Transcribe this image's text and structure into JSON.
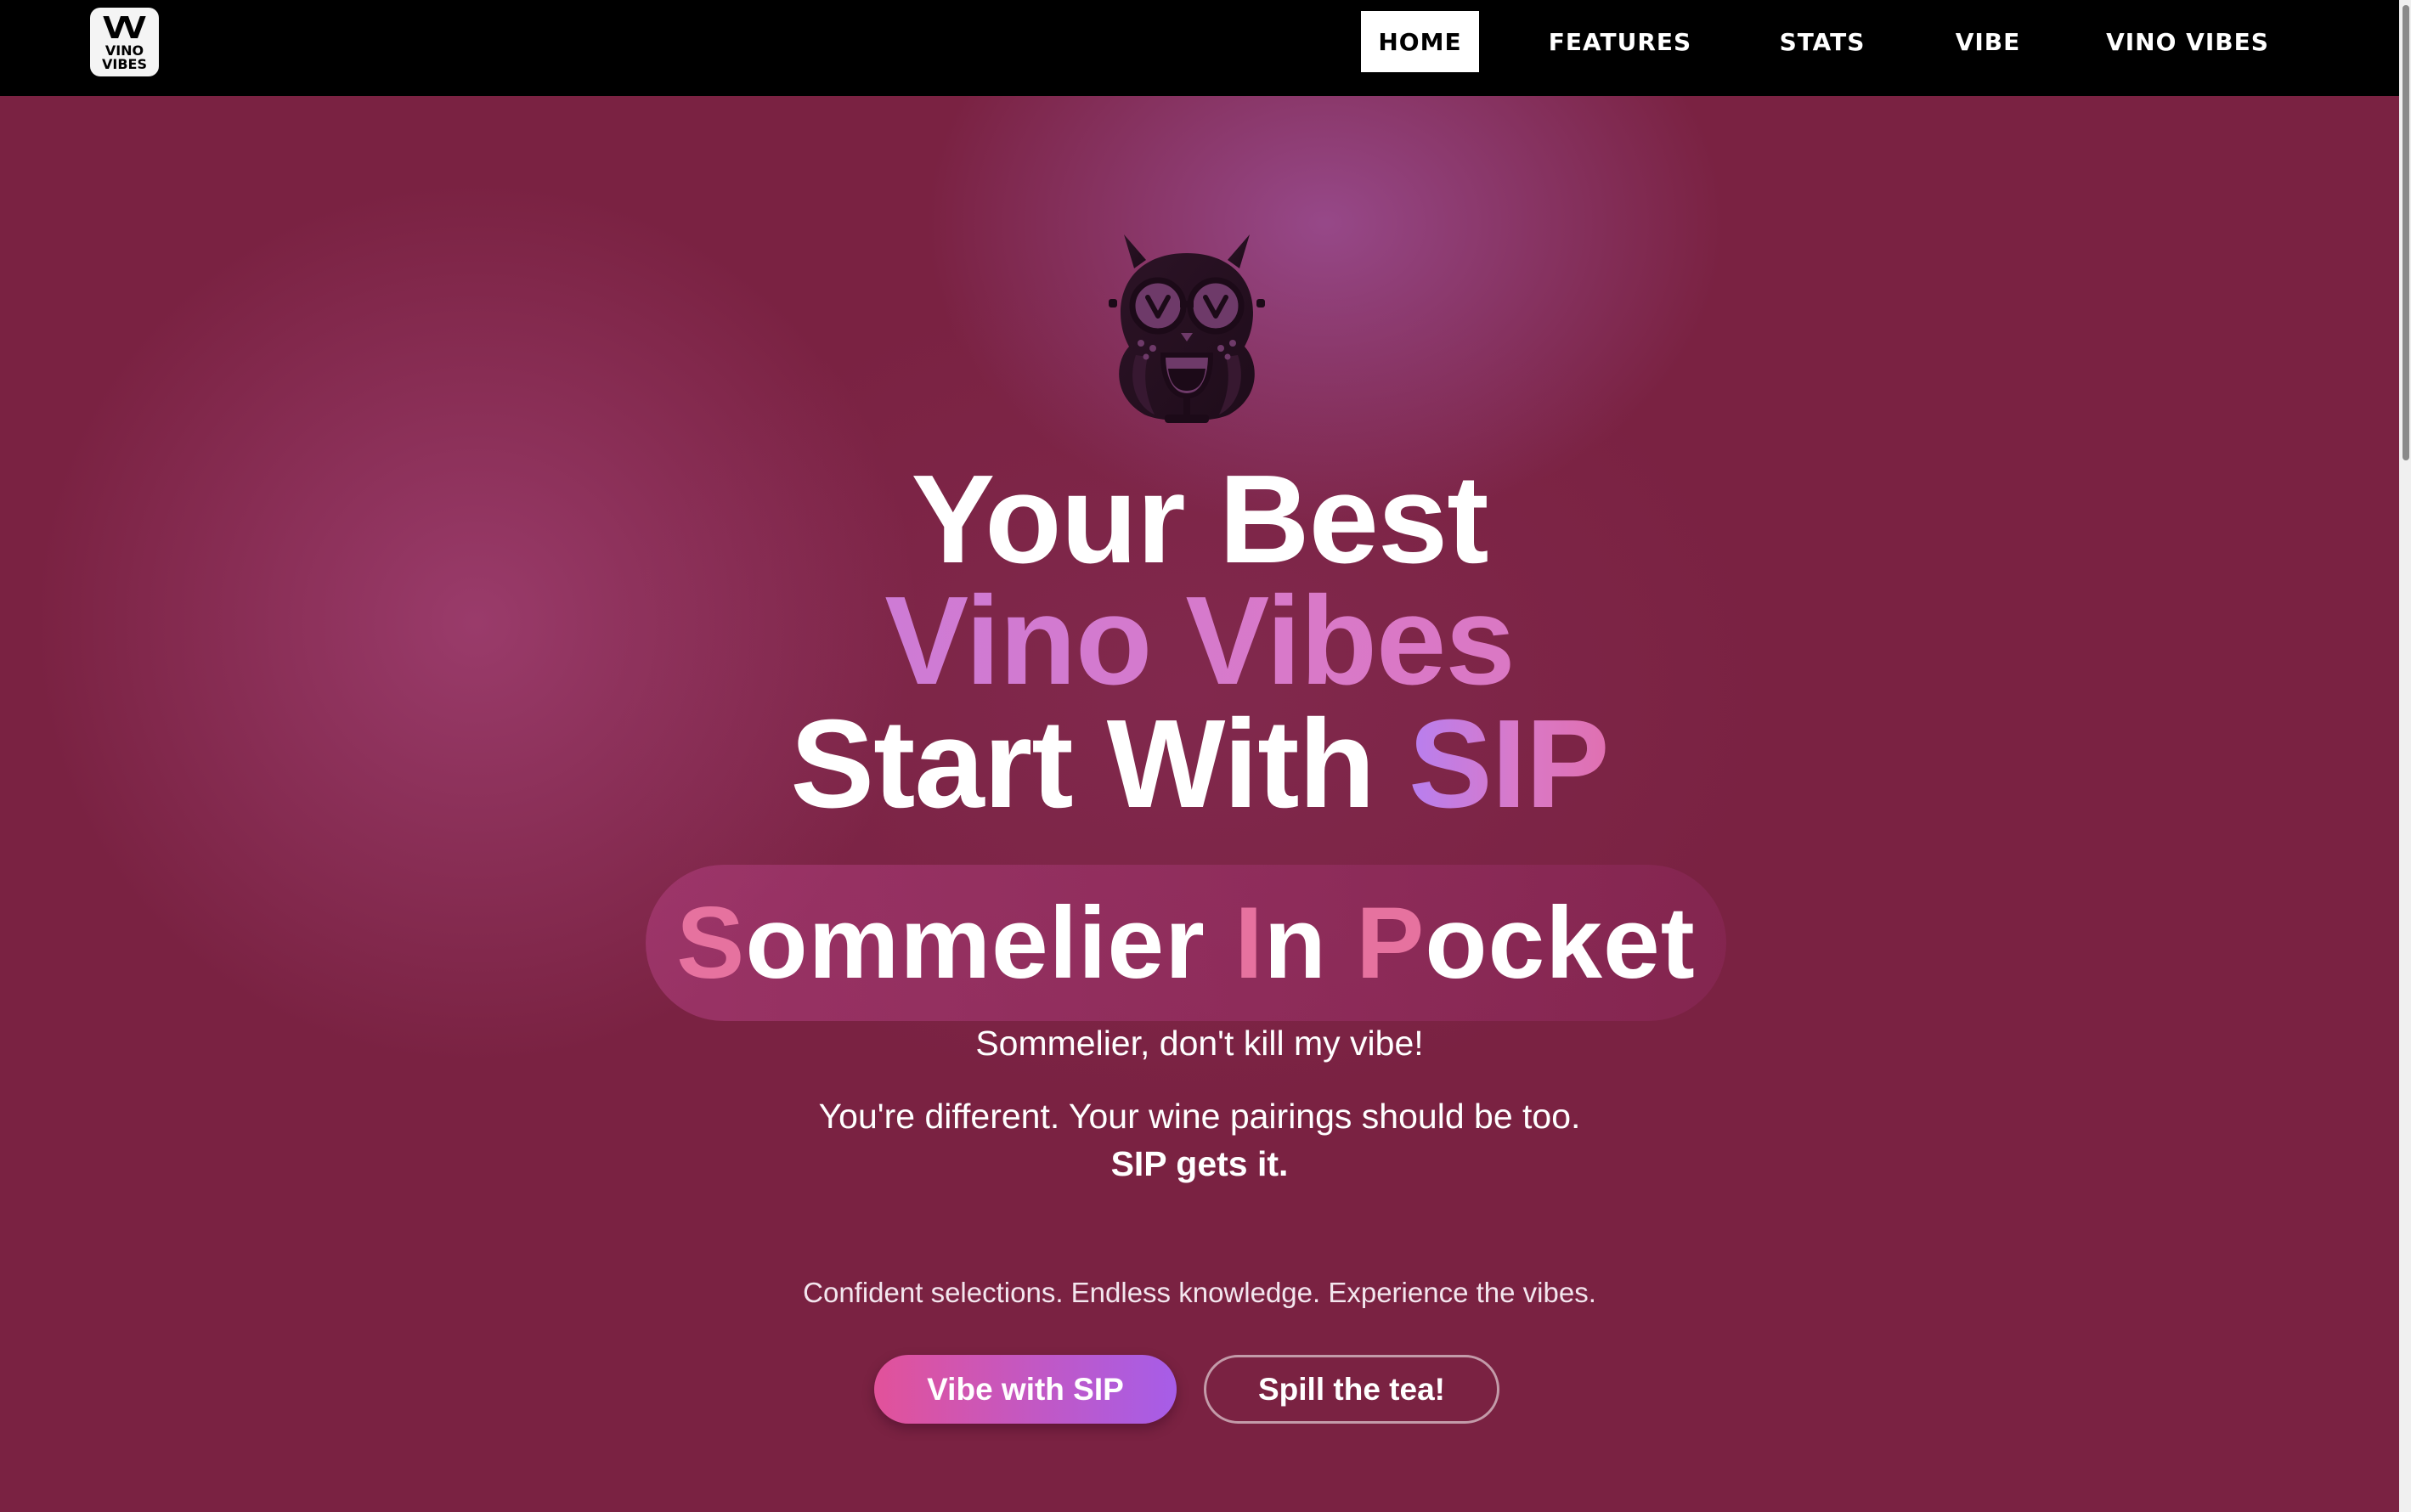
{
  "logo": {
    "mark": "VV",
    "line1": "VINO",
    "line2": "VIBES"
  },
  "nav": {
    "items": [
      {
        "label": "HOME",
        "active": true
      },
      {
        "label": "FEATURES",
        "active": false
      },
      {
        "label": "STATS",
        "active": false
      },
      {
        "label": "VIBE",
        "active": false
      },
      {
        "label": "VINO VIBES",
        "active": false
      }
    ]
  },
  "hero": {
    "headline": {
      "line1": "Your Best",
      "line2": "Vino Vibes",
      "line3_prefix": "Start With ",
      "line3_accent": "SIP"
    },
    "acronym": {
      "s": "S",
      "s_rest": "ommelier ",
      "i": "I",
      "i_rest": "n ",
      "p": "P",
      "p_rest": "ocket"
    },
    "tagline": "Sommelier, don't kill my vibe!",
    "pitch": "You're different. Your wine pairings should be too.",
    "pitch_bold": "SIP gets it.",
    "small_tag": "Confident selections. Endless knowledge. Experience the vibes.",
    "primary_button": "Vibe with SIP",
    "secondary_button": "Spill the tea!"
  },
  "icons": {
    "hero": "owl-wine-glass-icon"
  },
  "colors": {
    "background": "#7a2242",
    "navbar": "#000000",
    "accent_pink": "#e6729f",
    "gradient_start": "#b77ff0",
    "gradient_end": "#e070b0",
    "button_gradient": [
      "#e2529a",
      "#a65de8"
    ]
  }
}
